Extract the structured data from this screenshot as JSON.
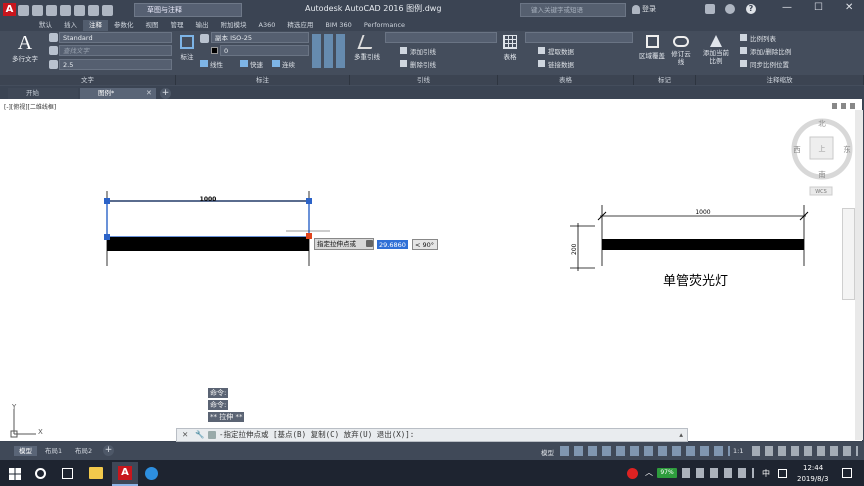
{
  "titlebar": {
    "app_title": "Autodesk AutoCAD 2016    图例.dwg",
    "workspace": "草图与注释",
    "search_placeholder": "键入关键字或短语",
    "signin": "登录",
    "min": "—",
    "max": "☐",
    "close": "✕"
  },
  "menus": [
    "默认",
    "插入",
    "注释",
    "参数化",
    "视图",
    "管理",
    "输出",
    "附加模块",
    "A360",
    "精选应用",
    "BIM 360",
    "Performance"
  ],
  "active_menu": "注释",
  "ribbon": {
    "text_big": "多行文字",
    "text_style": "Standard",
    "text_find": "查找文字",
    "text_height": "2.5",
    "dim_big": "标注",
    "dim_style": "副本 ISO-25",
    "dim_layer": "0",
    "dim_linear": "线性",
    "dim_quick": "快速",
    "dim_continue": "连续",
    "leader_big": "多重引线",
    "leader_add": "添加引线",
    "leader_remove": "删除引线",
    "table_big": "表格",
    "table_extract": "提取数据",
    "table_link": "链接数据",
    "mark_area": "区域覆盖",
    "mark_cloud": "修订云线",
    "scale_add": "添加当前比例",
    "scale_list": "比例列表",
    "scale_addremove": "添加/删除比例",
    "scale_sync": "同步比例位置",
    "panels": [
      "文字",
      "标注",
      "引线",
      "表格",
      "标记",
      "注释缩放"
    ]
  },
  "doctabs": {
    "start": "开始",
    "drawing": "图例*"
  },
  "viewport_label": "[-][俯视][二维线框]",
  "viewcube": {
    "north": "北",
    "south": "南",
    "west": "西",
    "east": "东",
    "top": "上",
    "wcs": "WCS"
  },
  "drawing": {
    "dim_left": "1000",
    "dim_right": "1000",
    "dim_height": "200",
    "caption": "单管荧光灯"
  },
  "grip_tooltip": {
    "prompt": "指定拉伸点或",
    "value": "29.6860",
    "angle": "< 90°"
  },
  "axis": {
    "x": "X",
    "y": "Y"
  },
  "command": {
    "history": [
      "命令:",
      "命令:",
      "** 拉伸 **"
    ],
    "prompt": "-指定拉伸点或 [基点(B) 复制(C) 放弃(U) 退出(X)]:"
  },
  "layouts": [
    "模型",
    "布局1",
    "布局2"
  ],
  "status": {
    "model": "模型",
    "scale": "1:1"
  },
  "taskbar": {
    "battery": "97%",
    "ime": "中",
    "time": "12:44",
    "date": "2019/8/3"
  }
}
